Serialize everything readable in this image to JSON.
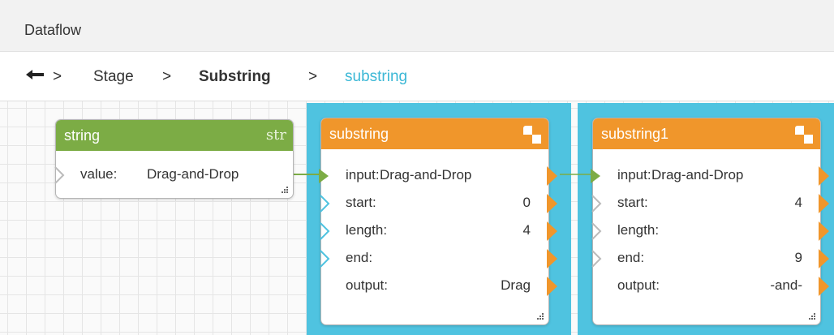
{
  "window": {
    "title": "Dataflow"
  },
  "breadcrumb": {
    "sep1": ">",
    "item1": "Stage",
    "sep2": ">",
    "item2": "Substring",
    "sep3": ">",
    "item3": "substring"
  },
  "nodes": {
    "string": {
      "title": "string",
      "type_tag": "str",
      "rows": {
        "value_label": "value:",
        "value_value": "Drag-and-Drop"
      }
    },
    "substring": {
      "title": "substring",
      "rows": {
        "input_label": "input:",
        "input_value": "Drag-and-Drop",
        "start_label": "start:",
        "start_value": "0",
        "length_label": "length:",
        "length_value": "4",
        "end_label": "end:",
        "end_value": "",
        "output_label": "output:",
        "output_value": "Drag"
      }
    },
    "substring1": {
      "title": "substring1",
      "rows": {
        "input_label": "input:",
        "input_value": "Drag-and-Drop",
        "start_label": "start:",
        "start_value": "4",
        "length_label": "length:",
        "length_value": "",
        "end_label": "end:",
        "end_value": "9",
        "output_label": "output:",
        "output_value": "-and-"
      }
    }
  },
  "colors": {
    "string_header": "#7cac45",
    "substring_header": "#f0962b",
    "selection": "#4fc3e0",
    "breadcrumb_current": "#3cb8d6",
    "wire": "#7cac45"
  },
  "icons": [
    "back-arrow-icon",
    "node-menu-icon",
    "resize-grip-icon",
    "input-port-icon",
    "output-port-icon"
  ]
}
